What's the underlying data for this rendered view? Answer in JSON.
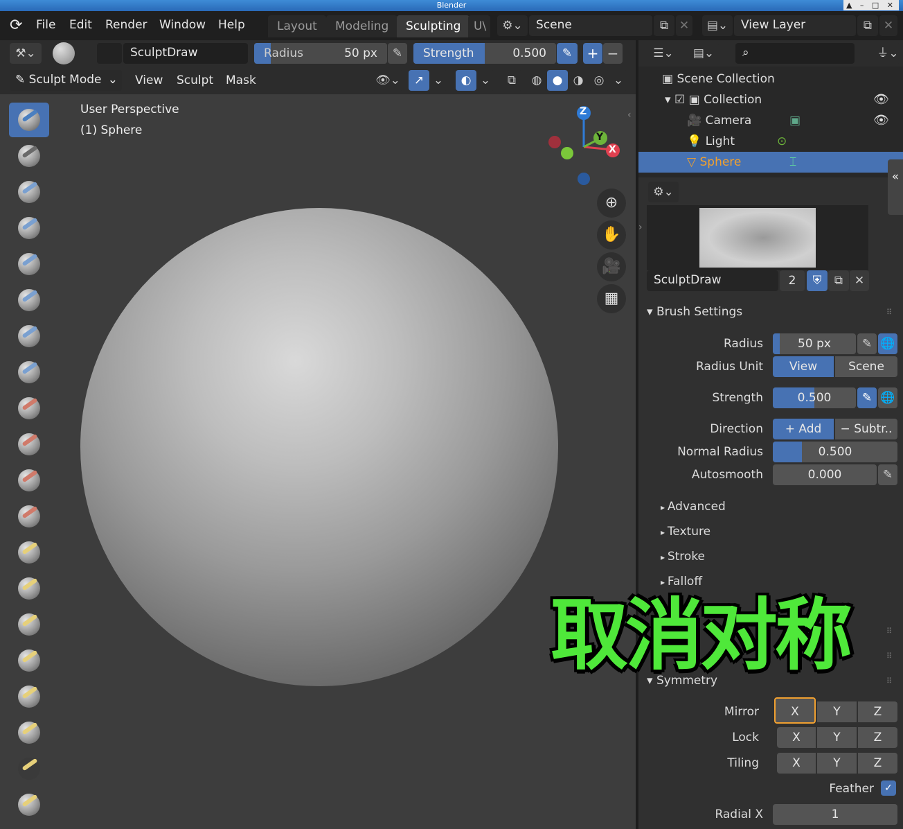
{
  "window": {
    "title": "Blender",
    "controls": "▲ – □ ✕"
  },
  "menu": {
    "items": [
      "File",
      "Edit",
      "Render",
      "Window",
      "Help"
    ]
  },
  "workspaces": {
    "tabs": [
      "Layout",
      "Modeling",
      "Sculpting",
      "U\\"
    ],
    "active": "Sculpting"
  },
  "scene": {
    "label": "Scene"
  },
  "view_layer": {
    "label": "View Layer"
  },
  "tool_header": {
    "brush_name": "SculptDraw",
    "radius_label": "Radius",
    "radius_value": "50 px",
    "strength_label": "Strength",
    "strength_value": "0.500",
    "plus": "+",
    "minus": "−"
  },
  "mode_header": {
    "mode": "Sculpt Mode",
    "menus": [
      "View",
      "Sculpt",
      "Mask"
    ]
  },
  "viewport": {
    "perspective": "User Perspective",
    "object": "(1) Sphere",
    "gizmo": {
      "z": "Z",
      "y": "Y",
      "x": "X"
    },
    "nav_icons": [
      "zoom-icon",
      "hand-pan-icon",
      "camera-icon",
      "grid-ortho-icon"
    ]
  },
  "outliner": {
    "scene_collection": "Scene Collection",
    "collection": "Collection",
    "items": [
      "Camera",
      "Light",
      "Sphere"
    ],
    "selected": "Sphere"
  },
  "brush_panel": {
    "name": "SculptDraw",
    "users": "2",
    "section_title": "Brush Settings",
    "radius_label": "Radius",
    "radius_value": "50 px",
    "radius_unit_label": "Radius Unit",
    "unit_view": "View",
    "unit_scene": "Scene",
    "strength_label": "Strength",
    "strength_value": "0.500",
    "direction_label": "Direction",
    "direction_add": "+   Add",
    "direction_subtract": "−  Subtr..",
    "normal_radius_label": "Normal Radius",
    "normal_radius_value": "0.500",
    "autosmooth_label": "Autosmooth",
    "autosmooth_value": "0.000",
    "subpanels": [
      "Advanced",
      "Texture",
      "Stroke",
      "Falloff"
    ]
  },
  "symmetry": {
    "title": "Symmetry",
    "mirror_label": "Mirror",
    "lock_label": "Lock",
    "tiling_label": "Tiling",
    "axes": [
      "X",
      "Y",
      "Z"
    ],
    "feather_label": "Feather",
    "radial_x_label": "Radial X",
    "radial_x_value": "1"
  },
  "overlay_caption": "取消对称",
  "colors": {
    "accent": "#4772b3",
    "active_object": "#f0a030",
    "highlight_border": "#f0a030",
    "caption": "#4fe83a"
  }
}
